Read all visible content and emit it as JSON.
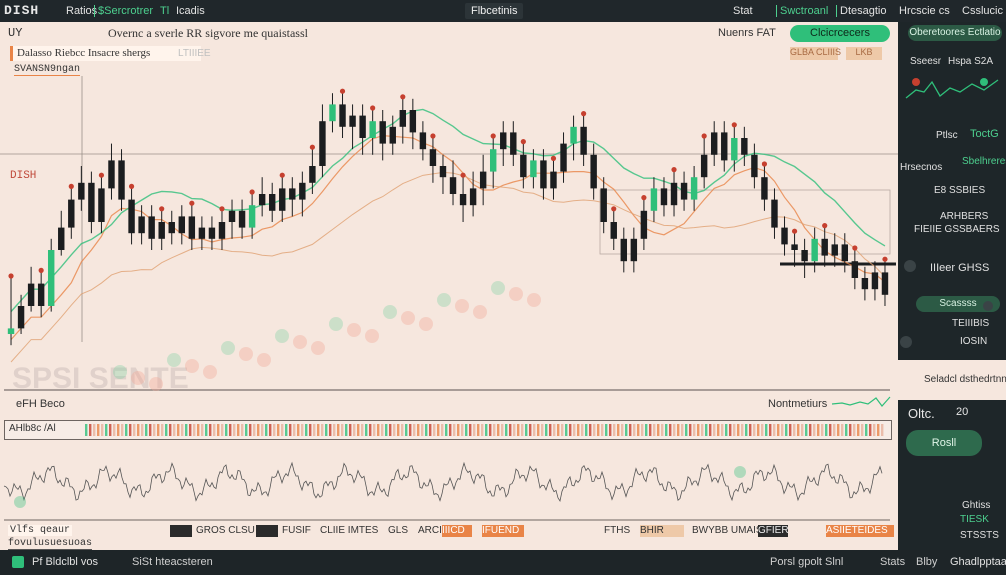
{
  "app": {
    "logo": "DISH",
    "menu": [
      "Ratios",
      "$Sercrotrer",
      "Tl",
      "Icadis"
    ],
    "center_tab": "Flbcetinis",
    "right_menu": [
      "Stat",
      "Swctroanl",
      "Dtesagtio",
      "Hrcscie cs",
      "Csslucic"
    ]
  },
  "chart_header": {
    "symbol": "UY",
    "title": "Overnc a sverle RR  sigvore me quaistassl",
    "right_label": "Nuenrs FAT",
    "primary_button": "Clcicrcecers",
    "toolbar_label": "Dalasso Riebcc Insacre shergs",
    "toolbar_tag": "LTIIIEE",
    "subtitle": "SVANSN9ngan",
    "right_small_1": "GLBA  CLIIIS",
    "right_small_2": "LKB",
    "level_label": "DISH",
    "watermark": "SPSI SENTE"
  },
  "indicator": {
    "title": "eFH Beco",
    "right_label": "Nontmetiurs",
    "row_label": "AHlb8c  /Al"
  },
  "footer_ticker": {
    "left_a": "Vlfs  qeaur",
    "left_b": "fovulusuesuoas",
    "items": [
      "GROS  CLSU",
      "FUSIF",
      "CLIIE  IMTES",
      "GLS",
      "ARCIB",
      "IIICD",
      "IFUEND"
    ],
    "right_label": "FTHS",
    "right_items": [
      "BHIR",
      "BWYBB  UMAIS",
      "GFIER",
      "ASIIETEIDES"
    ]
  },
  "right_panel": {
    "button_top": "Oberetoores  Ectlatio",
    "labels": [
      "Sseesr",
      "Hspa S2A",
      "Ptlsc",
      "ToctG",
      "Sbelhreres",
      "Hrsecnos",
      "E8  SSBIES",
      "ARHBERS",
      "FIEIIE  GSSBAERS",
      "IIIeer GHSS",
      "Scassss",
      "TEIIIBIS",
      "IOSIN"
    ],
    "section_title": "Seladcl dsthedrtnnr",
    "row_a": "Oltc.",
    "row_a_val": "20",
    "button_reset": "Rosll",
    "labels_bottom": [
      "Ghtiss",
      "TIESK",
      "STSSTS"
    ]
  },
  "bottom_bar": {
    "left_label": "Pf Bldclbl vos",
    "mid_label": "SiSt  hteacsteren",
    "right_items": [
      "Porsl  gpolt  Slnl",
      "Stats",
      "Blby",
      "Ghadlpptaa"
    ]
  },
  "chart_data": {
    "type": "candlestick",
    "title": "",
    "xlabel": "",
    "ylabel": "",
    "ylim": [
      0,
      100
    ],
    "candles": [
      [
        10,
        12,
        30,
        6
      ],
      [
        12,
        20,
        24,
        10
      ],
      [
        20,
        28,
        34,
        18
      ],
      [
        28,
        20,
        32,
        16
      ],
      [
        20,
        40,
        44,
        18
      ],
      [
        40,
        48,
        54,
        38
      ],
      [
        48,
        58,
        62,
        44
      ],
      [
        58,
        64,
        70,
        54
      ],
      [
        64,
        50,
        68,
        46
      ],
      [
        50,
        62,
        66,
        46
      ],
      [
        62,
        72,
        78,
        58
      ],
      [
        72,
        58,
        76,
        54
      ],
      [
        58,
        46,
        62,
        42
      ],
      [
        46,
        52,
        56,
        42
      ],
      [
        52,
        44,
        56,
        40
      ],
      [
        44,
        50,
        54,
        40
      ],
      [
        50,
        46,
        54,
        42
      ],
      [
        46,
        52,
        56,
        42
      ],
      [
        52,
        44,
        56,
        40
      ],
      [
        44,
        48,
        52,
        40
      ],
      [
        48,
        44,
        52,
        40
      ],
      [
        44,
        50,
        54,
        40
      ],
      [
        50,
        54,
        58,
        44
      ],
      [
        54,
        48,
        58,
        44
      ],
      [
        48,
        56,
        60,
        44
      ],
      [
        56,
        60,
        66,
        52
      ],
      [
        60,
        54,
        64,
        50
      ],
      [
        54,
        62,
        66,
        50
      ],
      [
        62,
        58,
        66,
        52
      ],
      [
        58,
        64,
        68,
        52
      ],
      [
        64,
        70,
        76,
        60
      ],
      [
        70,
        86,
        92,
        66
      ],
      [
        86,
        92,
        96,
        82
      ],
      [
        92,
        84,
        96,
        80
      ],
      [
        84,
        88,
        92,
        76
      ],
      [
        88,
        80,
        92,
        74
      ],
      [
        80,
        86,
        90,
        74
      ],
      [
        86,
        78,
        90,
        72
      ],
      [
        78,
        84,
        88,
        74
      ],
      [
        84,
        90,
        94,
        78
      ],
      [
        90,
        82,
        94,
        76
      ],
      [
        82,
        76,
        86,
        72
      ],
      [
        76,
        70,
        80,
        64
      ],
      [
        70,
        66,
        74,
        60
      ],
      [
        66,
        60,
        72,
        56
      ],
      [
        60,
        56,
        66,
        50
      ],
      [
        56,
        62,
        68,
        52
      ],
      [
        62,
        68,
        74,
        56
      ],
      [
        68,
        76,
        80,
        62
      ],
      [
        76,
        82,
        86,
        70
      ],
      [
        82,
        74,
        86,
        70
      ],
      [
        74,
        66,
        78,
        62
      ],
      [
        66,
        72,
        76,
        62
      ],
      [
        72,
        62,
        76,
        58
      ],
      [
        62,
        68,
        72,
        58
      ],
      [
        68,
        78,
        82,
        64
      ],
      [
        78,
        84,
        88,
        72
      ],
      [
        84,
        74,
        88,
        70
      ],
      [
        74,
        62,
        78,
        58
      ],
      [
        62,
        50,
        66,
        46
      ],
      [
        50,
        44,
        54,
        40
      ],
      [
        44,
        36,
        48,
        32
      ],
      [
        36,
        44,
        48,
        32
      ],
      [
        44,
        54,
        58,
        40
      ],
      [
        54,
        62,
        66,
        50
      ],
      [
        62,
        56,
        66,
        52
      ],
      [
        56,
        64,
        68,
        52
      ],
      [
        64,
        58,
        68,
        54
      ],
      [
        58,
        66,
        70,
        54
      ],
      [
        66,
        74,
        80,
        62
      ],
      [
        74,
        82,
        86,
        70
      ],
      [
        82,
        72,
        86,
        68
      ],
      [
        72,
        80,
        84,
        68
      ],
      [
        80,
        74,
        84,
        70
      ],
      [
        74,
        66,
        78,
        62
      ],
      [
        66,
        58,
        70,
        54
      ],
      [
        58,
        48,
        62,
        44
      ],
      [
        48,
        42,
        52,
        38
      ],
      [
        42,
        40,
        46,
        34
      ],
      [
        40,
        36,
        44,
        30
      ],
      [
        36,
        44,
        48,
        32
      ],
      [
        44,
        38,
        48,
        34
      ],
      [
        38,
        42,
        46,
        34
      ],
      [
        42,
        36,
        46,
        32
      ],
      [
        36,
        30,
        40,
        26
      ],
      [
        30,
        26,
        34,
        22
      ],
      [
        26,
        32,
        36,
        22
      ],
      [
        32,
        24,
        36,
        20
      ]
    ]
  },
  "colors": {
    "bg_chart": "#f6e7de",
    "bg_dark": "#1e2629",
    "accent_green": "#2fbf7a",
    "accent_red": "#c6402f",
    "accent_orange": "#e98447",
    "candle_dark": "#1b1d1f"
  }
}
